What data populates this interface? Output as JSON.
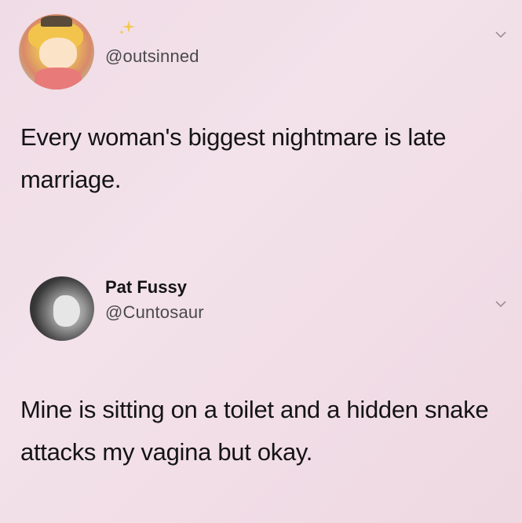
{
  "tweets": [
    {
      "handle": "@outsinned",
      "display_name": "",
      "text": "Every woman's biggest nightmare is late marriage."
    },
    {
      "handle": "@Cuntosaur",
      "display_name": "Pat Fussy",
      "text": "Mine is sitting on a toilet and a hidden snake attacks my vagina but okay."
    }
  ],
  "icons": {
    "avatar_1": "cartoon-avatar",
    "sparkle": "sparkle-icon",
    "chevron": "chevron-down-icon",
    "avatar_2": "photo-avatar"
  },
  "colors": {
    "background": "#f1dde6",
    "text": "#141414",
    "handle": "#4a4a4a",
    "sparkle": "#f2c94c"
  }
}
